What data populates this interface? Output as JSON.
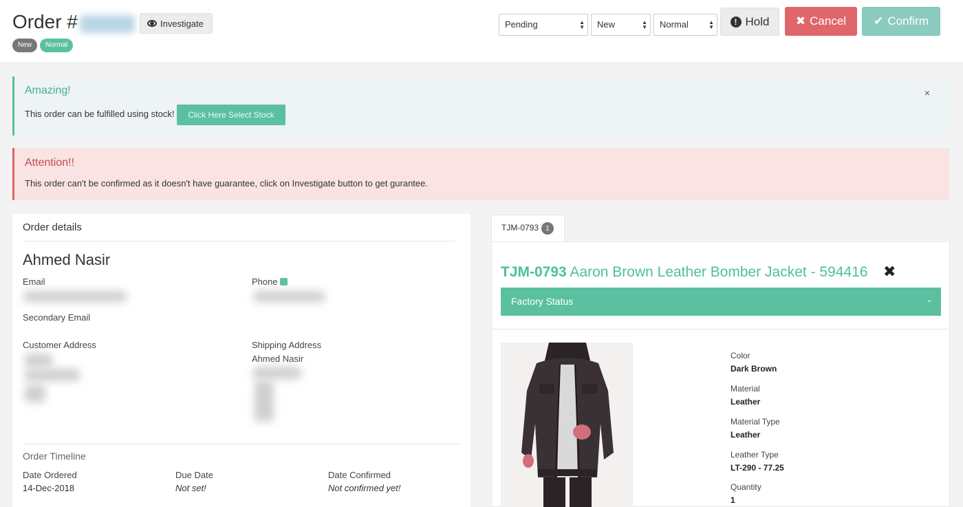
{
  "header": {
    "title": "Order #",
    "investigate_label": "Investigate",
    "badges": [
      "New",
      "Normal"
    ],
    "selects": [
      "Pending",
      "New",
      "Normal"
    ],
    "hold_label": "Hold",
    "cancel_label": "Cancel",
    "confirm_label": "Confirm"
  },
  "alerts": {
    "success_title": "Amazing!",
    "success_text": "This order can be fulfilled using stock!",
    "stock_button": "Click Here Select Stock",
    "close": "×",
    "danger_title": "Attention!!",
    "danger_text": "This order can't be confirmed as it doesn't have guarantee, click on Investigate button to get gurantee."
  },
  "order_details": {
    "panel_title": "Order details",
    "customer_name": "Ahmed Nasir",
    "email_label": "Email",
    "phone_label": "Phone",
    "secondary_email_label": "Secondary Email",
    "customer_address_label": "Customer Address",
    "shipping_address_label": "Shipping Address",
    "shipping_name": "Ahmed Nasir",
    "timeline_title": "Order Timeline",
    "timeline": {
      "date_ordered_label": "Date Ordered",
      "date_ordered": "14-Dec-2018",
      "due_date_label": "Due Date",
      "due_date": "Not set!",
      "date_confirmed_label": "Date Confirmed",
      "date_confirmed": "Not confirmed yet!"
    }
  },
  "product": {
    "tab_label": "TJM-0793",
    "tab_count": "1",
    "sku": "TJM-0793",
    "name": "Aaron Brown Leather Bomber Jacket - 594416",
    "remove": "✖",
    "factory_status": "Factory Status",
    "attributes": [
      {
        "label": "Color",
        "value": "Dark Brown"
      },
      {
        "label": "Material",
        "value": "Leather"
      },
      {
        "label": "Material Type",
        "value": "Leather"
      },
      {
        "label": "Leather Type",
        "value": "LT-290 - 77.25"
      },
      {
        "label": "Quantity",
        "value": "1"
      }
    ]
  },
  "colors": {
    "accent": "#5bc0a0",
    "danger": "#e0666a",
    "confirm": "#8ccbbf"
  }
}
